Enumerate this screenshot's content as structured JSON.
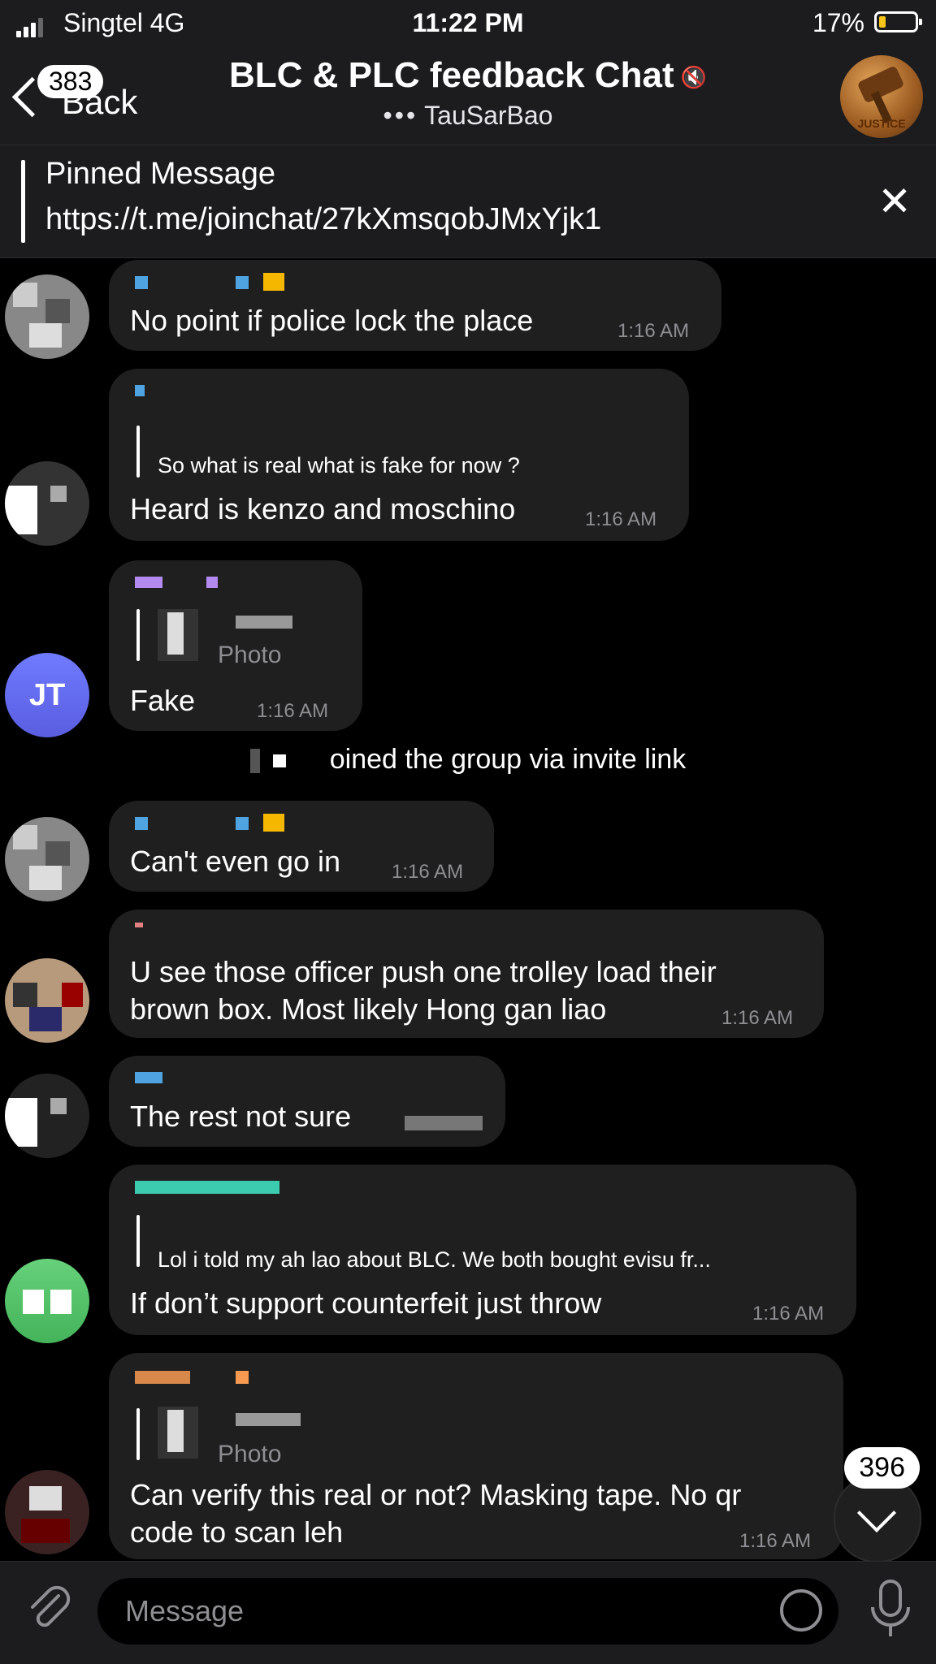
{
  "status": {
    "carrier": "Singtel  4G",
    "time": "11:22 PM",
    "battery": "17%",
    "battery_level": 0.17
  },
  "header": {
    "back_label": "Back",
    "back_badge": "383",
    "title": "BLC & PLC feedback Chat",
    "subtitle": "TauSarBao"
  },
  "pinned": {
    "title": "Pinned Message",
    "text": "https://t.me/joinchat/27kXmsqobJMxYjk1"
  },
  "messages": [
    {
      "text": "No point if police lock the place",
      "time": "1:16 AM"
    },
    {
      "reply_text": "So what is real what is fake for now ?",
      "text": "Heard is kenzo and moschino",
      "time": "1:16 AM"
    },
    {
      "avatar_initials": "JT",
      "reply_sub": "Photo",
      "text": "Fake",
      "time": "1:16 AM"
    },
    {
      "text": "Can't even go in",
      "time": "1:16 AM"
    },
    {
      "text": "U see those officer push one trolley load their\nbrown box.  Most likely Hong gan liao",
      "time": "1:16 AM"
    },
    {
      "text": "The rest not sure",
      "time": ""
    },
    {
      "reply_text": "Lol i told my ah lao about BLC. We both bought evisu fr...",
      "text": "If don’t support counterfeit just throw",
      "time": "1:16 AM"
    },
    {
      "reply_sub": "Photo",
      "text": "Can verify this real or not? Masking tape. No qr\ncode to scan leh",
      "time": "1:16 AM"
    }
  ],
  "system_message": "oined the group via invite link",
  "scroll_badge": "396",
  "input": {
    "placeholder": "Message"
  }
}
